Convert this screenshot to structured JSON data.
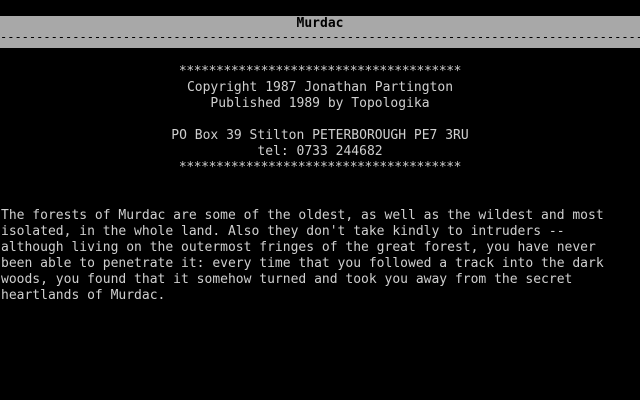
{
  "header": {
    "title": "Murdac",
    "rule": "--------------------------------------------------------------------------------------------------------------------------------"
  },
  "credits": {
    "stars_top": "**************************************",
    "copyright": "Copyright 1987 Jonathan Partington",
    "publisher": "Published 1989 by Topologika",
    "address": "PO Box 39 Stilton PETERBOROUGH PE7 3RU",
    "tel": "tel: 0733 244682",
    "stars_bottom": "**************************************"
  },
  "intro": {
    "lines": [
      "The forests of Murdac are some of the oldest, as well as the wildest and most",
      "isolated, in the whole land. Also they don't take kindly to intruders --",
      "although living on the outermost fringes of the great forest, you have never",
      "been able to penetrate it: every time that you followed a track into the dark",
      "woods, you found that it somehow turned and took you away from the secret",
      "heartlands of Murdac."
    ]
  },
  "colors": {
    "background": "#000000",
    "text": "#cfcfcf",
    "bar": "#a8a8a8"
  }
}
